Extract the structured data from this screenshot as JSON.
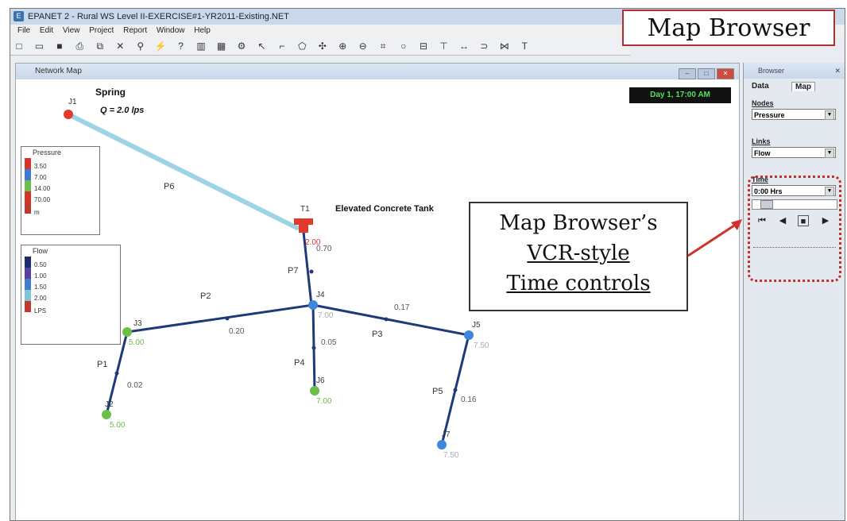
{
  "window": {
    "title": "EPANET 2 - Rural WS Level II-EXERCISE#1-YR2011-Existing.NET",
    "menus": [
      "File",
      "Edit",
      "View",
      "Project",
      "Report",
      "Window",
      "Help"
    ]
  },
  "toolbar_icons": [
    "new-icon",
    "open-icon",
    "save-icon",
    "print-icon",
    "copy-icon",
    "delete-icon",
    "find-icon",
    "run-icon",
    "query-icon",
    "graph-icon",
    "table-icon",
    "options-icon",
    "select-icon",
    "vertex-icon",
    "region-icon",
    "pan-icon",
    "zoom-in-icon",
    "zoom-out-icon",
    "full-extent-icon",
    "junction-icon",
    "reservoir-icon",
    "tank-icon",
    "pipe-icon",
    "pump-icon",
    "valve-icon",
    "label-icon"
  ],
  "annotations": {
    "map_browser": "Map Browser",
    "vcr_line1": "Map Browser’s",
    "vcr_line2": "VCR-style",
    "vcr_line3": "Time controls",
    "accent": "#c0312b"
  },
  "network_map": {
    "title": "Network Map",
    "clock": "Day 1, 17:00 AM",
    "labels": {
      "spring": "Spring",
      "flow": "Q = 2.0 lps",
      "tank": "Elevated Concrete Tank"
    },
    "nodes": [
      {
        "id": "J1",
        "value": ""
      },
      {
        "id": "T1",
        "value": "2.00"
      },
      {
        "id": "J4",
        "value": "7.00"
      },
      {
        "id": "J3",
        "value": "5.00"
      },
      {
        "id": "J2",
        "value": "5.00"
      },
      {
        "id": "J6",
        "value": "7.00"
      },
      {
        "id": "J5",
        "value": "7.50"
      },
      {
        "id": "J7",
        "value": "7.50"
      }
    ],
    "links": [
      {
        "id": "P6",
        "value": ""
      },
      {
        "id": "P7",
        "value": "0.70"
      },
      {
        "id": "P2",
        "value": "0.20"
      },
      {
        "id": "P3",
        "value": "0.17"
      },
      {
        "id": "P4",
        "value": "0.05"
      },
      {
        "id": "P1",
        "value": "0.02"
      },
      {
        "id": "P5",
        "value": "0.16"
      }
    ],
    "pressure_legend": {
      "title": "Pressure",
      "values": [
        "3.50",
        "7.00",
        "14.00",
        "70.00"
      ],
      "unit": "m",
      "colors": [
        "#d9342b",
        "#3a7bd5",
        "#6cc04a",
        "#d9342b",
        "#c0392b"
      ]
    },
    "flow_legend": {
      "title": "Flow",
      "values": [
        "0.50",
        "1.00",
        "1.50",
        "2.00"
      ],
      "unit": "LPS",
      "colors": [
        "#1b2b6b",
        "#5b3fa0",
        "#3f7fd0",
        "#7fc7d8",
        "#c0392b"
      ]
    }
  },
  "browser": {
    "title": "Browser",
    "tabs": [
      "Data",
      "Map"
    ],
    "active_tab": "Map",
    "nodes_label": "Nodes",
    "nodes_value": "Pressure",
    "links_label": "Links",
    "links_value": "Flow",
    "time_label": "Time",
    "time_value": "0:00 Hrs"
  }
}
